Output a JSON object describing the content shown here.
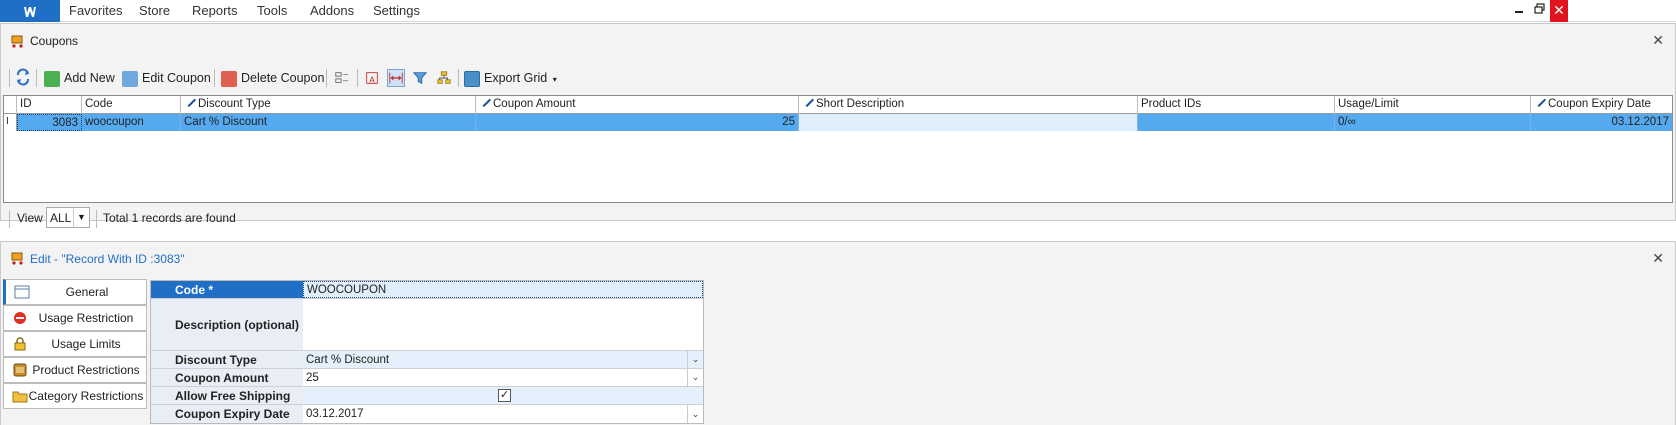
{
  "menubar": {
    "app_icon": "app-logo-icon",
    "items": [
      "Favorites",
      "Store",
      "Reports",
      "Tools",
      "Addons",
      "Settings"
    ],
    "minimize": "▬",
    "restore": "🗗",
    "close": "✕"
  },
  "coupons_panel": {
    "title": "Coupons",
    "close": "✕",
    "toolbar": {
      "add_new": "Add New",
      "edit_coupon": "Edit Coupon",
      "delete_coupon": "Delete Coupon",
      "export_grid": "Export Grid"
    },
    "grid": {
      "columns": [
        "ID",
        "Code",
        "Discount Type",
        "Coupon Amount",
        "Short Description",
        "Product IDs",
        "Usage/Limit",
        "Coupon Expiry Date"
      ],
      "rows": [
        {
          "id": "3083",
          "code": "woocoupon",
          "discount_type": "Cart % Discount",
          "coupon_amount": "25",
          "short_description": "",
          "product_ids": "",
          "usage_limit": "0/∞",
          "expiry": "03.12.2017"
        }
      ]
    },
    "status": {
      "view_label": "View",
      "view_value": "ALL",
      "total_text": "Total 1 records are found"
    }
  },
  "edit_panel": {
    "title": "Edit - \"Record With ID :3083\"",
    "close": "✕",
    "tabs": [
      "General",
      "Usage Restriction",
      "Usage Limits",
      "Product Restrictions",
      "Category Restrictions"
    ],
    "form": {
      "code_label": "Code *",
      "code_value": "WOOCOUPON",
      "description_label": "Description (optional)",
      "description_value": "",
      "discount_type_label": "Discount Type",
      "discount_type_value": "Cart % Discount",
      "coupon_amount_label": "Coupon Amount",
      "coupon_amount_value": "25",
      "free_shipping_label": "Allow Free Shipping",
      "free_shipping_checked": true,
      "expiry_label": "Coupon Expiry Date",
      "expiry_value": "03.12.2017"
    }
  },
  "colors": {
    "accent": "#1f6fc7",
    "selected_row": "#55aaef",
    "selected_cell": "#dfeefb",
    "close_red": "#e0141e"
  }
}
